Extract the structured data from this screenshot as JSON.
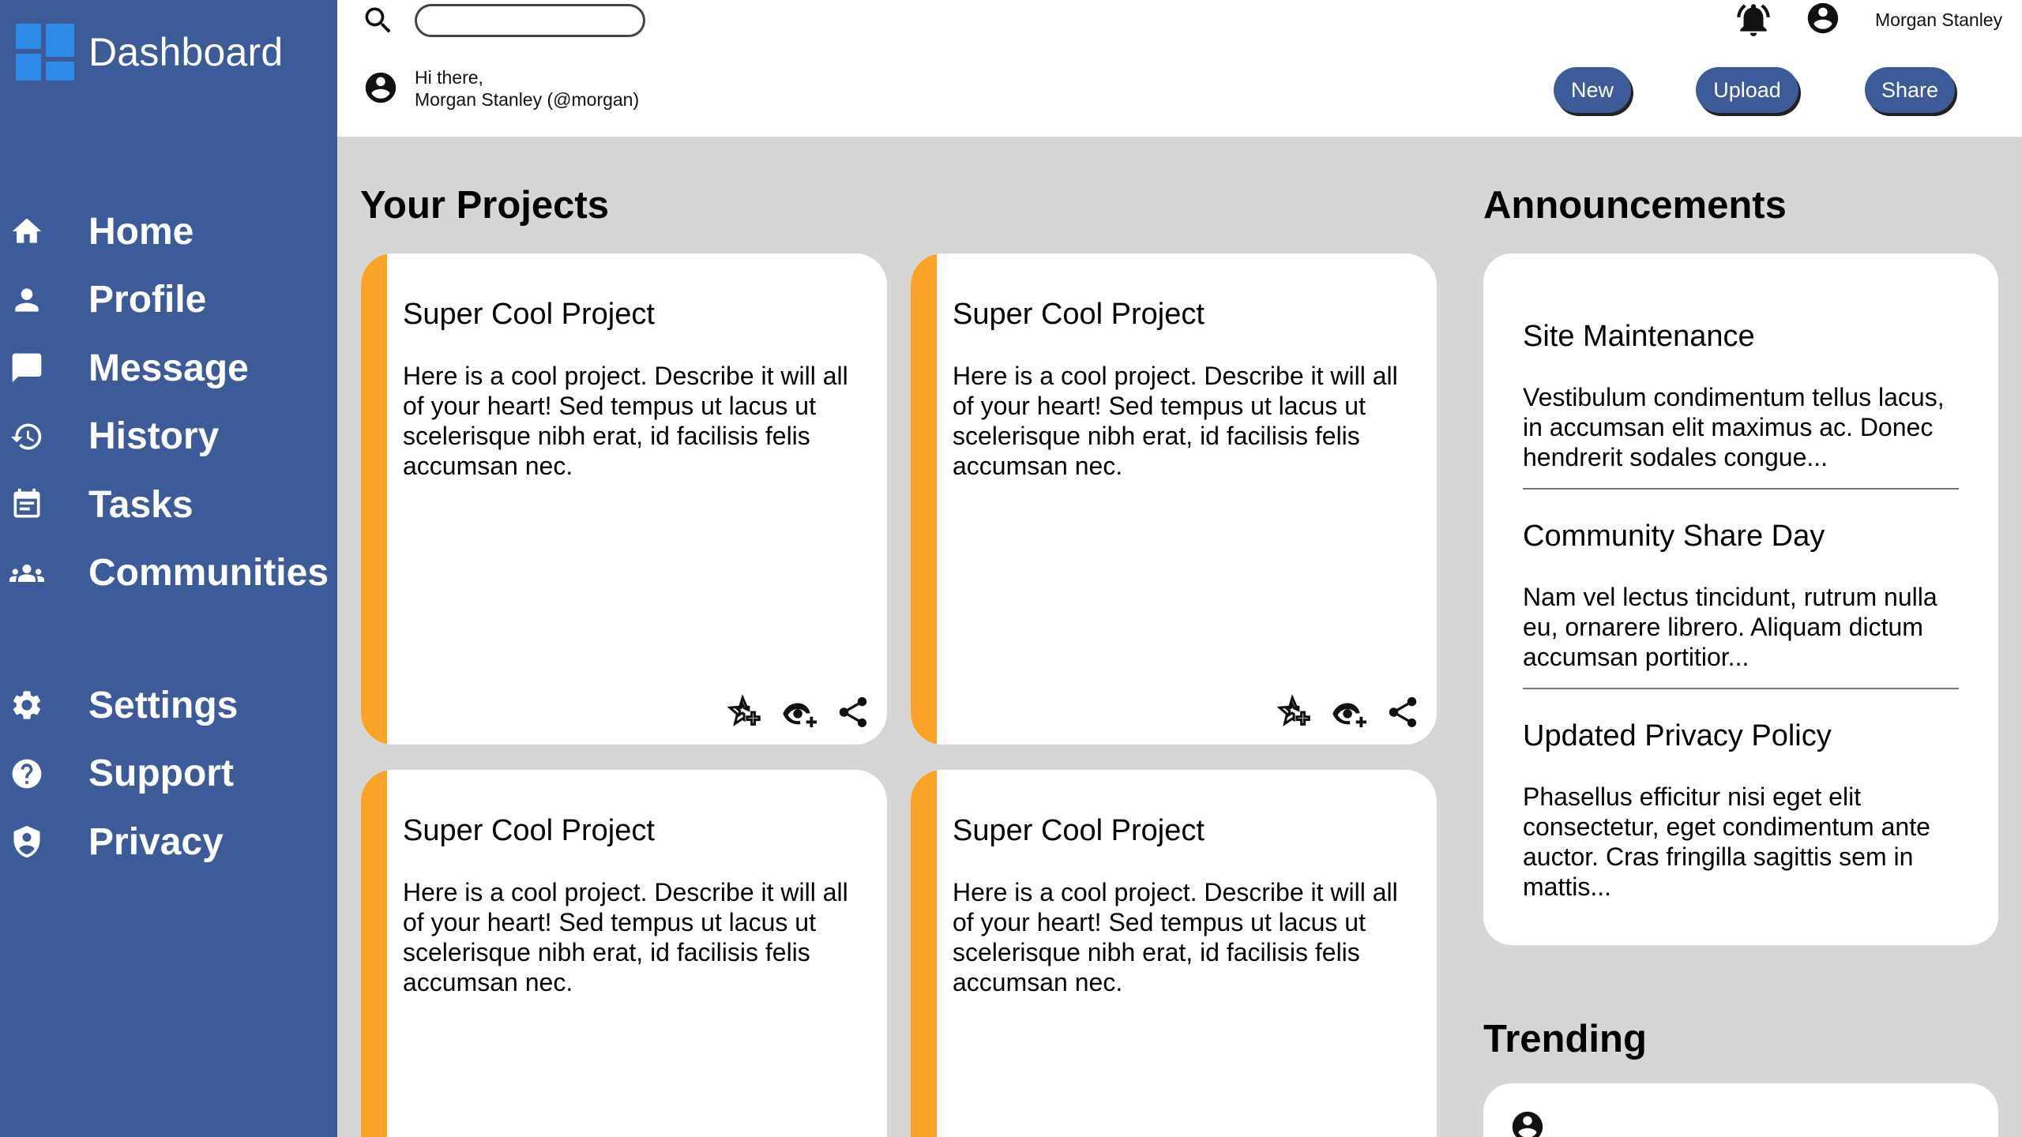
{
  "sidebar": {
    "brand_title": "Dashboard",
    "primary_items": [
      {
        "label": "Home",
        "icon": "home-icon"
      },
      {
        "label": "Profile",
        "icon": "profile-icon"
      },
      {
        "label": "Message",
        "icon": "message-icon"
      },
      {
        "label": "History",
        "icon": "history-icon"
      },
      {
        "label": "Tasks",
        "icon": "tasks-icon"
      },
      {
        "label": "Communities",
        "icon": "communities-icon"
      }
    ],
    "secondary_items": [
      {
        "label": "Settings",
        "icon": "gear-icon"
      },
      {
        "label": "Support",
        "icon": "help-icon"
      },
      {
        "label": "Privacy",
        "icon": "shield-icon"
      }
    ]
  },
  "header": {
    "search": {
      "placeholder": "",
      "value": ""
    },
    "greeting_line1": "Hi there,",
    "greeting_line2": "Morgan Stanley (@morgan)",
    "user_name": "Morgan Stanley",
    "buttons": {
      "new": "New",
      "upload": "Upload",
      "share": "Share"
    }
  },
  "main": {
    "projects_title": "Your Projects",
    "projects": [
      {
        "title": "Super Cool Project",
        "description": "Here is a cool project. Describe it will all of your heart! Sed tempus ut lacus ut scelerisque nibh erat, id facilisis felis accumsan nec."
      },
      {
        "title": "Super Cool Project",
        "description": "Here is a cool project. Describe it will all of your heart! Sed tempus ut lacus ut scelerisque nibh erat, id facilisis felis accumsan nec."
      },
      {
        "title": "Super Cool Project",
        "description": "Here is a cool project. Describe it will all of your heart! Sed tempus ut lacus ut scelerisque nibh erat, id facilisis felis accumsan nec."
      },
      {
        "title": "Super Cool Project",
        "description": "Here is a cool project. Describe it will all of your heart! Sed tempus ut lacus ut scelerisque nibh erat, id facilisis felis accumsan nec."
      }
    ],
    "announcements_title": "Announcements",
    "announcements": [
      {
        "title": "Site Maintenance",
        "body": "Vestibulum condimentum tellus lacus, in accumsan elit maximus ac. Donec hendrerit sodales congue..."
      },
      {
        "title": "Community Share Day",
        "body": "Nam vel lectus tincidunt, rutrum nulla eu, ornarere librero. Aliquam dictum accumsan portitior..."
      },
      {
        "title": "Updated Privacy Policy",
        "body": "Phasellus efficitur nisi eget elit consectetur, eget condimentum ante auctor. Cras fringilla sagittis sem in mattis..."
      }
    ],
    "trending_title": "Trending"
  },
  "colors": {
    "sidebar_bg": "#3d5a99",
    "accent_orange": "#f9a428",
    "button_bg": "#3d5a99",
    "content_bg": "#d6d6d6",
    "logo_blue": "#2f8ae8"
  }
}
